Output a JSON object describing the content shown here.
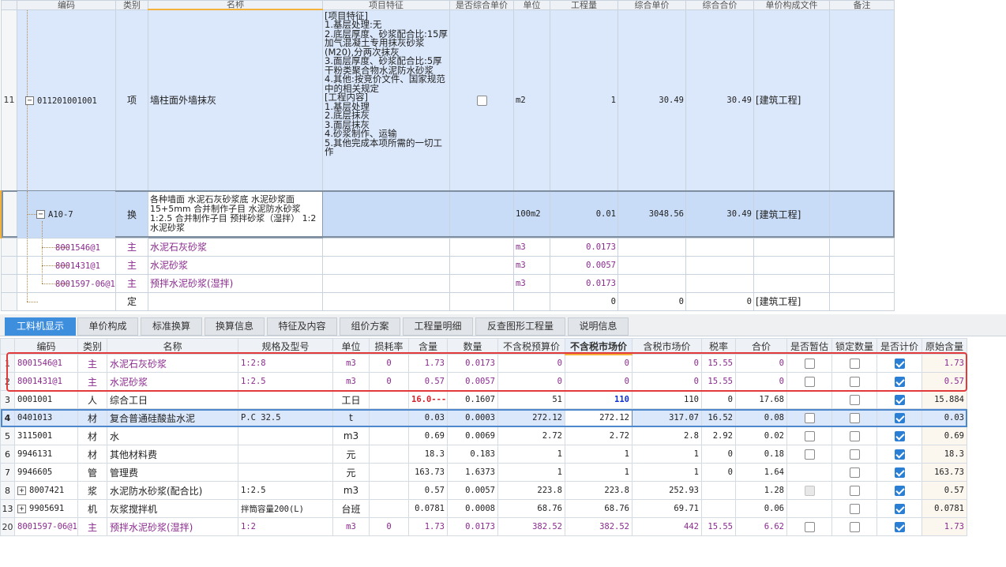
{
  "upper": {
    "header": [
      "编码",
      "类别",
      "名称",
      "项目特征",
      "是否综合单价",
      "单位",
      "工程量",
      "综合单价",
      "综合合价",
      "单价构成文件",
      "备注"
    ],
    "item_row": {
      "row_no": "11",
      "code": "011201001001",
      "type": "项",
      "name": "墙柱面外墙抹灰",
      "feature": "[项目特征]\n1.基层处理:无\n2.底层厚度、砂浆配合比:15厚加气混凝土专用抹灰砂浆(M20),分两次抹灰\n3.面层厚度、砂浆配合比:5厚干粉类聚合物水泥防水砂浆\n4.其他:按竞价文件、国家规范中的相关规定\n[工程内容]\n1.基层处理\n2.底层抹灰\n3.面层抹灰\n4.砂浆制作、运输\n5.其他完成本项所需的一切工作",
      "unit": "m2",
      "qty": "1",
      "unit_price": "30.49",
      "total": "30.49",
      "file": "[建筑工程]"
    },
    "sub_row": {
      "code": "A10-7",
      "type": "换",
      "name": "各种墙面 水泥石灰砂浆底 水泥砂浆面 15+5mm  合并制作子目 水泥防水砂浆 1:2.5  合并制作子目 预拌砂浆（湿拌） 1:2 水泥砂浆",
      "unit": "100m2",
      "qty": "0.01",
      "unit_price": "3048.56",
      "total": "30.49",
      "file": "[建筑工程]"
    },
    "materials": [
      {
        "code": "8001546@1",
        "type": "主",
        "name": "水泥石灰砂浆",
        "unit": "m3",
        "qty": "0.0173"
      },
      {
        "code": "8001431@1",
        "type": "主",
        "name": "水泥砂浆",
        "unit": "m3",
        "qty": "0.0057"
      },
      {
        "code": "8001597-06@1",
        "type": "主",
        "name": "预拌水泥砂浆(湿拌)",
        "unit": "m3",
        "qty": "0.0173"
      }
    ],
    "fixed_row": {
      "type": "定",
      "qty": "0",
      "unit_price": "0",
      "total": "0",
      "file": "[建筑工程]"
    }
  },
  "tabs": [
    "工料机显示",
    "单价构成",
    "标准换算",
    "换算信息",
    "特征及内容",
    "组价方案",
    "工程量明细",
    "反查图形工程量",
    "说明信息"
  ],
  "lower": {
    "header": [
      "编码",
      "类别",
      "名称",
      "规格及型号",
      "单位",
      "损耗率",
      "含量",
      "数量",
      "不含税预算价",
      "不含税市场价",
      "含税市场价",
      "税率",
      "合价",
      "是否暂估",
      "锁定数量",
      "是否计价",
      "原始含量"
    ],
    "rows": [
      {
        "no": "1",
        "code": "8001546@1",
        "type": "主",
        "name": "水泥石灰砂浆",
        "spec": "1:2:8",
        "unit": "m3",
        "loss": "0",
        "content": "1.73",
        "qty": "0.0173",
        "budget": "0",
        "market": "0",
        "tax_market": "0",
        "tax": "15.55",
        "total": "0",
        "orig": "1.73"
      },
      {
        "no": "2",
        "code": "8001431@1",
        "type": "主",
        "name": "水泥砂浆",
        "spec": "1:2.5",
        "unit": "m3",
        "loss": "0",
        "content": "0.57",
        "qty": "0.0057",
        "budget": "0",
        "market": "0",
        "tax_market": "0",
        "tax": "15.55",
        "total": "0",
        "orig": "0.57"
      },
      {
        "no": "3",
        "code": "0001001",
        "type": "人",
        "name": "综合工日",
        "spec": "",
        "unit": "工日",
        "loss": "",
        "content": "16.0---",
        "qty": "0.1607",
        "budget": "51",
        "market": "110",
        "tax_market": "110",
        "tax": "0",
        "total": "17.68",
        "orig": "15.884"
      },
      {
        "no": "4",
        "code": "0401013",
        "type": "材",
        "name": "复合普通硅酸盐水泥",
        "spec": "P.C 32.5",
        "unit": "t",
        "loss": "",
        "content": "0.03",
        "qty": "0.0003",
        "budget": "272.12",
        "market": "272.12",
        "tax_market": "317.07",
        "tax": "16.52",
        "total": "0.08",
        "orig": "0.03"
      },
      {
        "no": "5",
        "code": "3115001",
        "type": "材",
        "name": "水",
        "spec": "",
        "unit": "m3",
        "loss": "",
        "content": "0.69",
        "qty": "0.0069",
        "budget": "2.72",
        "market": "2.72",
        "tax_market": "2.8",
        "tax": "2.92",
        "total": "0.02",
        "orig": "0.69"
      },
      {
        "no": "6",
        "code": "9946131",
        "type": "材",
        "name": "其他材料费",
        "spec": "",
        "unit": "元",
        "loss": "",
        "content": "18.3",
        "qty": "0.183",
        "budget": "1",
        "market": "1",
        "tax_market": "1",
        "tax": "0",
        "total": "0.18",
        "orig": "18.3"
      },
      {
        "no": "7",
        "code": "9946605",
        "type": "管",
        "name": "管理费",
        "spec": "",
        "unit": "元",
        "loss": "",
        "content": "163.73",
        "qty": "1.6373",
        "budget": "1",
        "market": "1",
        "tax_market": "1",
        "tax": "0",
        "total": "1.64",
        "orig": "163.73"
      },
      {
        "no": "8",
        "code": "8007421",
        "type": "浆",
        "name": "水泥防水砂浆(配合比)",
        "spec": "1:2.5",
        "unit": "m3",
        "loss": "",
        "content": "0.57",
        "qty": "0.0057",
        "budget": "223.8",
        "market": "223.8",
        "tax_market": "252.93",
        "tax": "",
        "total": "1.28",
        "orig": "0.57"
      },
      {
        "no": "13",
        "code": "9905691",
        "type": "机",
        "name": "灰浆搅拌机",
        "spec": "拌筒容量200(L)",
        "unit": "台班",
        "loss": "",
        "content": "0.0781",
        "qty": "0.0008",
        "budget": "68.76",
        "market": "68.76",
        "tax_market": "69.71",
        "tax": "",
        "total": "0.06",
        "orig": "0.0781"
      },
      {
        "no": "20",
        "code": "8001597-06@1",
        "type": "主",
        "name": "预拌水泥砂浆(湿拌)",
        "spec": "1:2",
        "unit": "m3",
        "loss": "0",
        "content": "1.73",
        "qty": "0.0173",
        "budget": "382.52",
        "market": "382.52",
        "tax_market": "442",
        "tax": "15.55",
        "total": "6.62",
        "orig": "1.73"
      }
    ]
  },
  "colors": {
    "accent": "#3e8ede",
    "purple": "#8a2a8e",
    "highlight": "#e23a3a"
  }
}
